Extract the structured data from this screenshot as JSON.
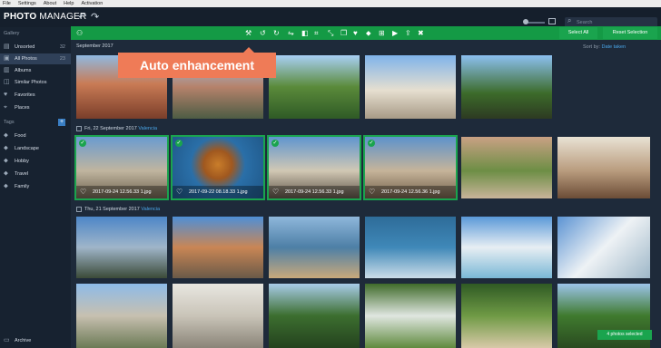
{
  "menu": [
    "File",
    "Settings",
    "About",
    "Help",
    "Activation"
  ],
  "app": {
    "logo_bold": "PHOTO",
    "logo_thin": "MANAGER"
  },
  "search": {
    "placeholder": "Search"
  },
  "sidebar": {
    "gallery_heading": "Gallery",
    "items": [
      {
        "label": "Unsorted",
        "count": "32",
        "icon": "unsorted-icon"
      },
      {
        "label": "All Photos",
        "count": "23",
        "icon": "photos-icon"
      },
      {
        "label": "Albums",
        "count": "",
        "icon": "albums-icon"
      },
      {
        "label": "Similar Photos",
        "count": "",
        "icon": "similar-icon"
      },
      {
        "label": "Favorites",
        "count": "",
        "icon": "heart-icon"
      },
      {
        "label": "Places",
        "count": "",
        "icon": "location-icon"
      }
    ],
    "tags_heading": "Tags",
    "tags": [
      "Food",
      "Landscape",
      "Hobby",
      "Travel",
      "Family"
    ],
    "archive_label": "Archive"
  },
  "toolbar": {
    "select_all": "Select All",
    "reset_selection": "Reset Selection",
    "icons": [
      "magic-wand-icon",
      "rotate-left-icon",
      "rotate-right-icon",
      "flip-icon",
      "compare-icon",
      "crop-icon",
      "resize-icon",
      "copy-icon",
      "heart-icon",
      "tag-icon",
      "album-add-icon",
      "slideshow-icon",
      "share-icon",
      "delete-icon"
    ]
  },
  "tooltip": "Auto enhancement",
  "content": {
    "sort_label": "Sort by:",
    "sort_value": "Date taken",
    "groups": [
      {
        "title": "September 2017",
        "location": ""
      },
      {
        "title": "Fri, 22 September 2017",
        "location": "Valencia"
      },
      {
        "title": "Thu, 21 September 2017",
        "location": "Valencia"
      }
    ],
    "filenames": [
      "2017-09-24 12.56.33 1.jpg",
      "2017-09-22 08.18.33 1.jpg",
      "2017-09-24 12.56.33 1.jpg",
      "2017-09-24 12.56.36 1.jpg"
    ]
  },
  "status": {
    "selected": "4 photos selected"
  },
  "colors": {
    "accent_green": "#149a45",
    "tooltip": "#ef7b57",
    "link_blue": "#4aa6e8"
  }
}
